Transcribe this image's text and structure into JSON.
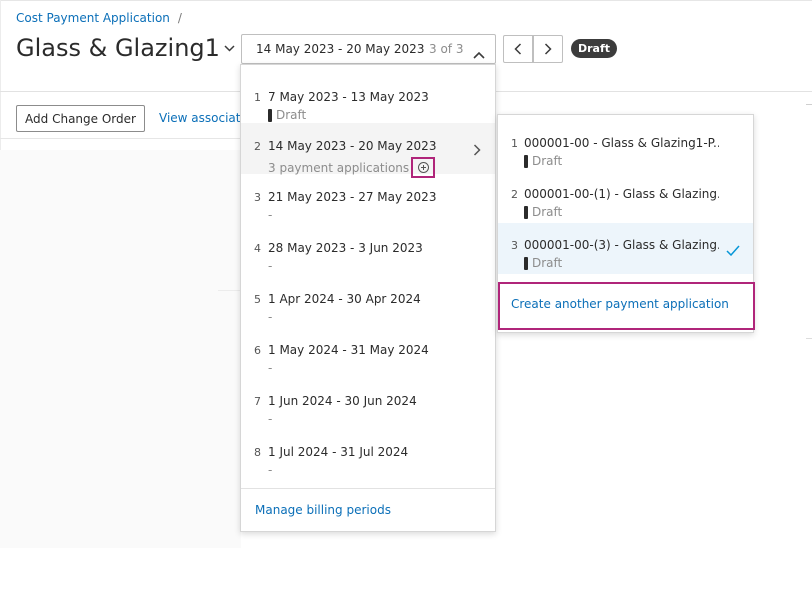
{
  "breadcrumb": {
    "label": "Cost Payment Application",
    "separator": "/"
  },
  "header": {
    "title": "Glass & Glazing1",
    "period_select": {
      "value": "14 May 2023 - 20 May 2023",
      "counter": "3 of 3"
    },
    "status_badge": "Draft"
  },
  "toolbar": {
    "add_change_order_label": "Add Change Order",
    "view_link_label": "View associate"
  },
  "period_dropdown": {
    "items": [
      {
        "num": "1",
        "label": "7 May 2023 - 13 May 2023",
        "sub": "Draft"
      },
      {
        "num": "2",
        "label": "14 May 2023 - 20 May 2023",
        "sub": "3 payment applications"
      },
      {
        "num": "3",
        "label": "21 May 2023 - 27 May 2023",
        "sub": "-"
      },
      {
        "num": "4",
        "label": "28 May 2023 - 3 Jun 2023",
        "sub": "-"
      },
      {
        "num": "5",
        "label": "1 Apr 2024 - 30 Apr 2024",
        "sub": "-"
      },
      {
        "num": "6",
        "label": "1 May 2024 - 31 May 2024",
        "sub": "-"
      },
      {
        "num": "7",
        "label": "1 Jun 2024 - 30 Jun 2024",
        "sub": "-"
      },
      {
        "num": "8",
        "label": "1 Jul 2024 - 31 Jul 2024",
        "sub": "-"
      }
    ],
    "manage_label": "Manage billing periods"
  },
  "applications_submenu": {
    "items": [
      {
        "num": "1",
        "label": "000001-00 - Glass & Glazing1-P...",
        "status": "Draft"
      },
      {
        "num": "2",
        "label": "000001-00-(1) - Glass & Glazing...",
        "status": "Draft"
      },
      {
        "num": "3",
        "label": "000001-00-(3) - Glass & Glazing...",
        "status": "Draft"
      }
    ],
    "create_label": "Create another payment application"
  },
  "colors": {
    "link": "#0b6fb8",
    "highlight": "#b0257a",
    "selected_bg": "#edf5fb",
    "check": "#0696d7"
  }
}
